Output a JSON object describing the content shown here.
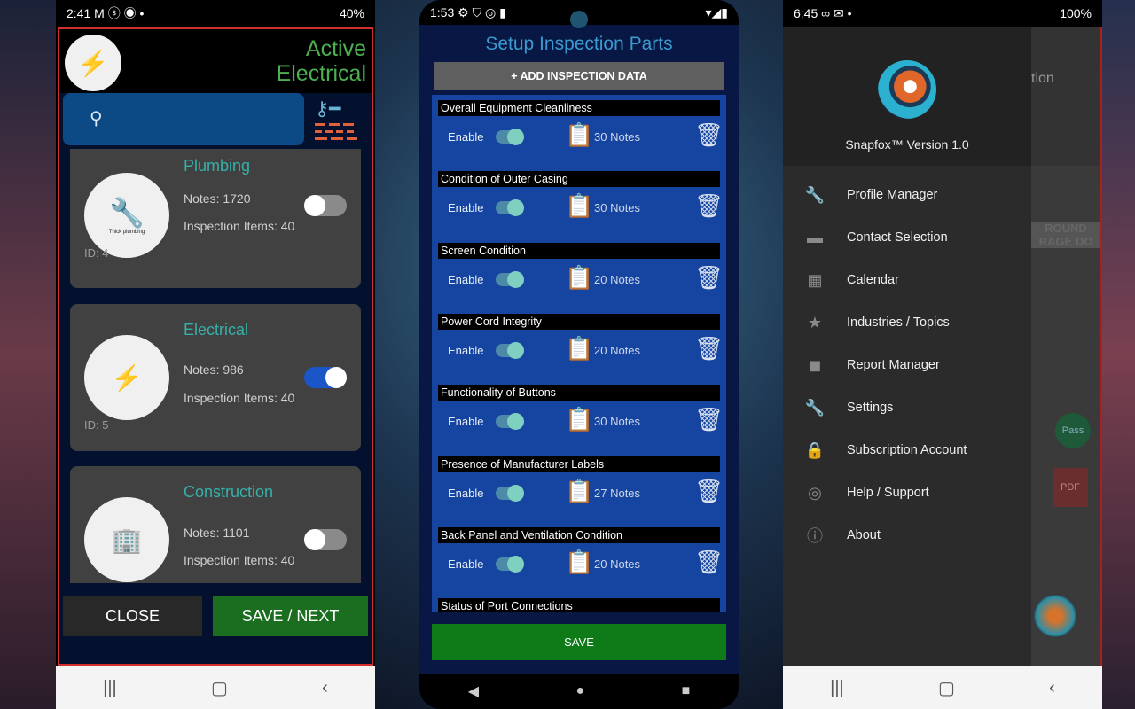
{
  "phone1": {
    "status": {
      "time": "2:41",
      "icons": "M ⓢ ◉ •",
      "right": "40%"
    },
    "header": {
      "title_line1": "Active",
      "title_line2": "Electrical",
      "logo_icon": "electrical-tools"
    },
    "search": {
      "icon": "search-icon",
      "value": ""
    },
    "cards": [
      {
        "name": "Plumbing",
        "notes": "Notes: 1720",
        "items": "Inspection Items: 40",
        "id": "ID: 4",
        "logo_caption": "Thick plumbing",
        "enabled": false
      },
      {
        "name": "Electrical",
        "notes": "Notes: 986",
        "items": "Inspection Items: 40",
        "id": "ID: 5",
        "enabled": true
      },
      {
        "name": "Construction",
        "notes": "Notes: 1101",
        "items": "Inspection Items: 40",
        "enabled": false
      }
    ],
    "buttons": {
      "close": "CLOSE",
      "save": "SAVE / NEXT"
    },
    "colors": {
      "accent": "#4caf50",
      "teal": "#36b0a8",
      "save": "#1b6e1f"
    }
  },
  "phone2": {
    "status": {
      "time": "1:53"
    },
    "title": "Setup Inspection Parts",
    "add_button": "+ ADD INSPECTION DATA",
    "enable_label": "Enable",
    "items": [
      {
        "name": "Overall Equipment Cleanliness",
        "notes": "30 Notes"
      },
      {
        "name": "Condition of Outer Casing",
        "notes": "30 Notes"
      },
      {
        "name": "Screen Condition",
        "notes": "20 Notes"
      },
      {
        "name": "Power Cord Integrity",
        "notes": "20 Notes"
      },
      {
        "name": "Functionality of Buttons",
        "notes": "30 Notes"
      },
      {
        "name": "Presence of Manufacturer Labels",
        "notes": "27 Notes"
      },
      {
        "name": "Back Panel and Ventilation Condition",
        "notes": "20 Notes"
      },
      {
        "name": "Status of Port Connections",
        "notes": ""
      }
    ],
    "save": "SAVE"
  },
  "phone3": {
    "status": {
      "time": "6:45",
      "right": "100%"
    },
    "version": "Snapfox™ Version 1.0",
    "menu": [
      {
        "label": "Profile Manager",
        "icon": "wrench-icon"
      },
      {
        "label": "Contact Selection",
        "icon": "folder-icon"
      },
      {
        "label": "Calendar",
        "icon": "calendar-icon"
      },
      {
        "label": "Industries / Topics",
        "icon": "star-icon"
      },
      {
        "label": "Report Manager",
        "icon": "report-icon"
      },
      {
        "label": "Settings",
        "icon": "wrench-icon"
      },
      {
        "label": "Subscription Account",
        "icon": "lock-icon"
      },
      {
        "label": "Help / Support",
        "icon": "lifebuoy-icon"
      },
      {
        "label": "About",
        "icon": "info-icon"
      }
    ],
    "behind": {
      "partial_title": "tion",
      "pass_badge": "Pass",
      "pdf_badge": "PDF",
      "sign_line1": "ROUND",
      "sign_line2": "RAGE DO"
    }
  }
}
